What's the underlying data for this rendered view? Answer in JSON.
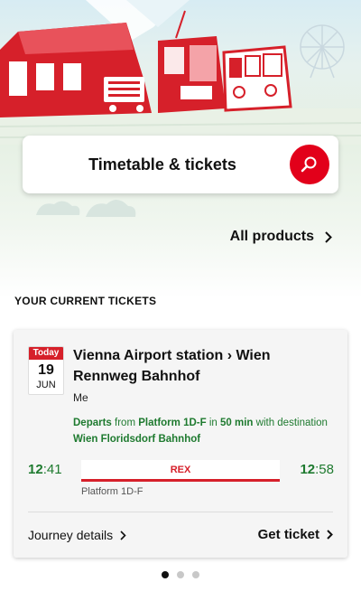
{
  "search": {
    "label": "Timetable & tickets"
  },
  "products": {
    "label": "All products"
  },
  "section": {
    "title": "YOUR CURRENT TICKETS"
  },
  "ticket": {
    "date": {
      "dow": "Today",
      "day": "19",
      "month": "JUN"
    },
    "route": "Vienna Airport station › Wien Rennweg Bahnhof",
    "passenger": "Me",
    "departure": {
      "departs_word": "Departs",
      "from_word": "from",
      "platform": "Platform 1D-F",
      "in_word": "in",
      "minutes": "50 min",
      "with_word": "with destination",
      "destination": "Wien Floridsdorf Bahnhof"
    },
    "dep_time": {
      "hour": "12",
      "min": ":41"
    },
    "arr_time": {
      "hour": "12",
      "min": ":58"
    },
    "train": "REX",
    "platform": "Platform 1D-F",
    "journey_label": "Journey details",
    "get_ticket_label": "Get ticket"
  },
  "pager": {
    "total": 3,
    "active": 0
  },
  "colors": {
    "accent": "#e2001a",
    "green": "#1e7a2f"
  }
}
